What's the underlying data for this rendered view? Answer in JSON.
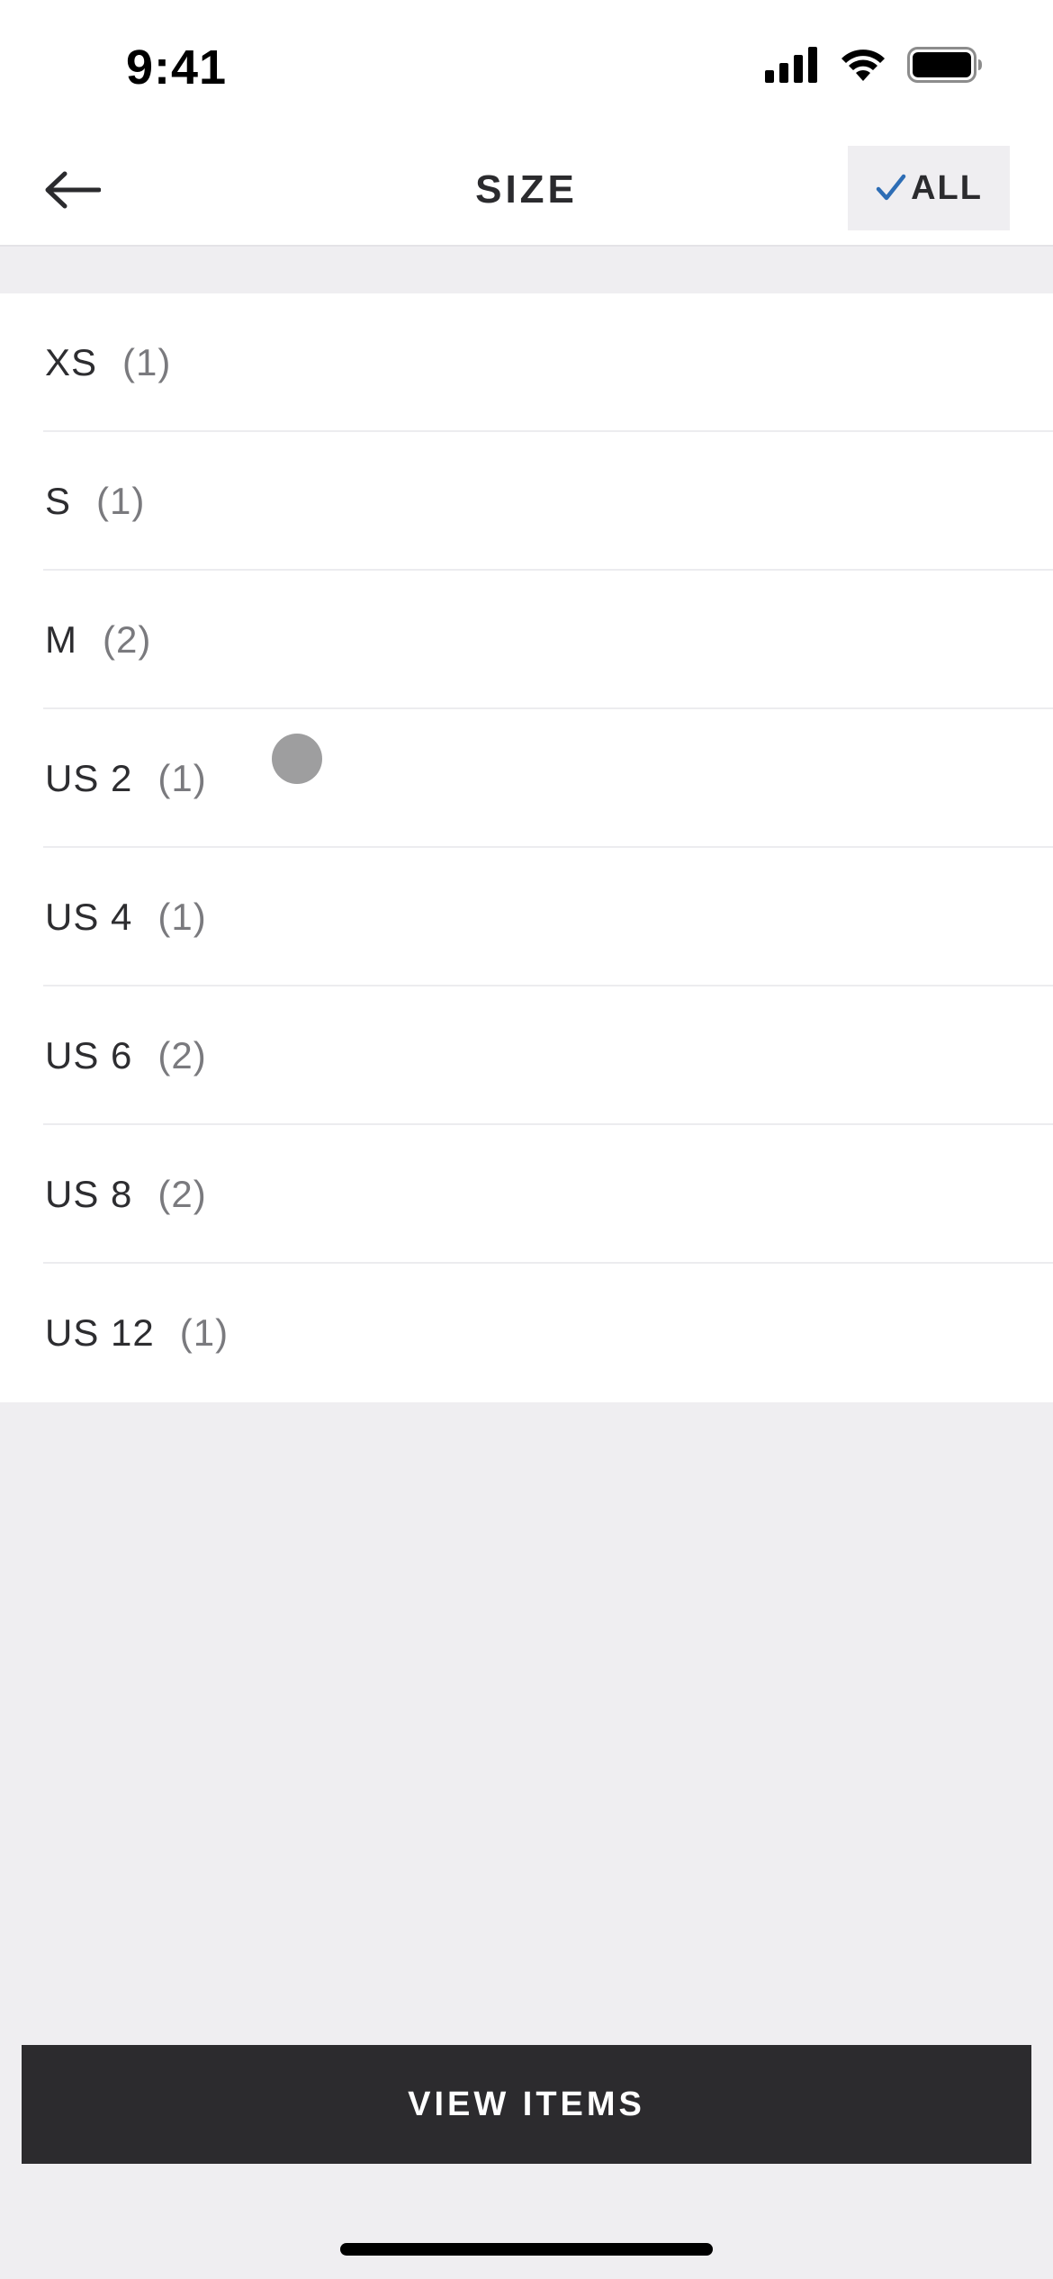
{
  "status_bar": {
    "time": "9:41"
  },
  "header": {
    "title": "SIZE",
    "select_all_label": "ALL",
    "check_color": "#2d6db5"
  },
  "sizes": [
    {
      "name": "XS",
      "count": "(1)"
    },
    {
      "name": "S",
      "count": "(1)"
    },
    {
      "name": "M",
      "count": "(2)"
    },
    {
      "name": "US 2",
      "count": "(1)"
    },
    {
      "name": "US 4",
      "count": "(1)"
    },
    {
      "name": "US 6",
      "count": "(2)"
    },
    {
      "name": "US 8",
      "count": "(2)"
    },
    {
      "name": "US 12",
      "count": "(1)"
    }
  ],
  "footer": {
    "view_items_label": "VIEW ITEMS"
  },
  "colors": {
    "background": "#efeef1",
    "button": "#2c2b2e",
    "text": "#2d2d30",
    "count_text": "#7a7a7e"
  },
  "icons": {
    "back": "arrow-left-icon",
    "check": "checkmark-icon",
    "signal": "cellular-signal-icon",
    "wifi": "wifi-icon",
    "battery": "battery-icon"
  }
}
